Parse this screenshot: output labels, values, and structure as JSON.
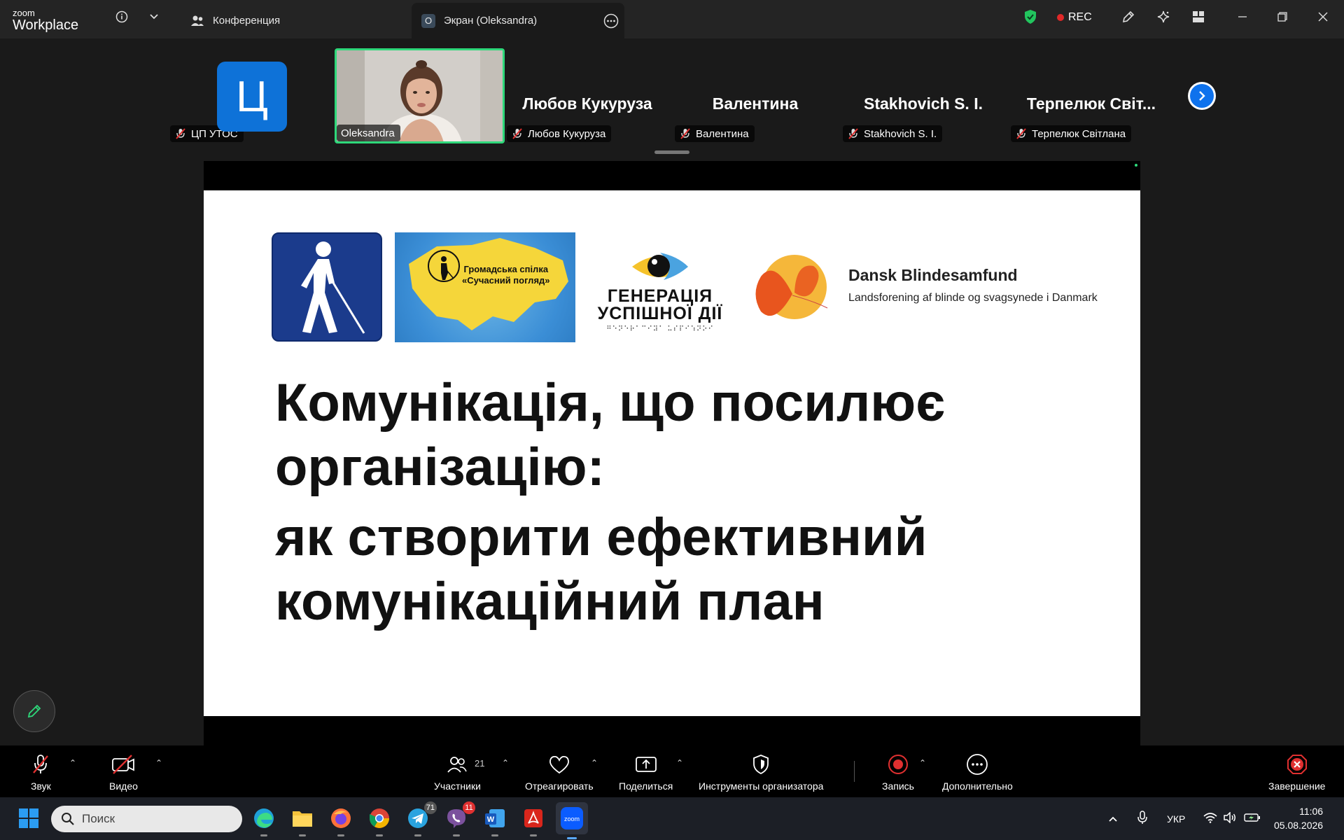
{
  "app": {
    "logo_line1": "zoom",
    "logo_line2": "Workplace"
  },
  "tabs": [
    {
      "label": "Конференция",
      "icon": "participants-icon"
    },
    {
      "label": "Экран (Oleksandra)",
      "icon": "screen-share-icon",
      "active": true
    }
  ],
  "titlebar": {
    "rec_label": "REC",
    "rec_color": "#e02828",
    "shield_color": "#22c55e"
  },
  "participants": [
    {
      "name": "ЦП УТОС",
      "avatar_letter": "Ц",
      "muted": true
    },
    {
      "name": "Oleksandra",
      "video": true,
      "speaking": true
    },
    {
      "name": "Любов Кукуруза",
      "display": "Любов Кукуруза",
      "muted": true
    },
    {
      "name": "Валентина",
      "display": "Валентина",
      "muted": true
    },
    {
      "name": "Stakhovich S. I.",
      "display": "Stakhovich S. I.",
      "muted": true
    },
    {
      "name": "Терпелюк Світлана",
      "display": "Терпелюк  Світ...",
      "muted": true
    }
  ],
  "slide": {
    "map_logo_line1": "Громадська спілка",
    "map_logo_line2": "«Сучасний погляд»",
    "gen_line1": "ГЕНЕРАЦІЯ",
    "gen_line2": "УСПІШНОЇ ДІЇ",
    "gen_braille": "⠛⠑⠝⠑⠗⠁⠉⠊⠽⠁ ⠥⠎⠏⠊⠱⠝⠕⠊",
    "dansk_name": "Dansk Blindesamfund",
    "dansk_sub": "Landsforening af blinde og svagsynede i Danmark",
    "title": "Комунікація, що посилює організацію:",
    "subtitle": "як створити ефективний комунікаційний план"
  },
  "toolbar": {
    "audio": "Звук",
    "video": "Видео",
    "participants": "Участники",
    "participants_count": "21",
    "react": "Отреагировать",
    "share": "Поделиться",
    "host_tools": "Инструменты организатора",
    "record": "Запись",
    "more": "Дополнительно",
    "end": "Завершение"
  },
  "taskbar": {
    "search_placeholder": "Поиск",
    "telegram_badge": "71",
    "viber_badge": "11",
    "language": "УКР",
    "time": "11:06",
    "date": "05.08.2026"
  }
}
